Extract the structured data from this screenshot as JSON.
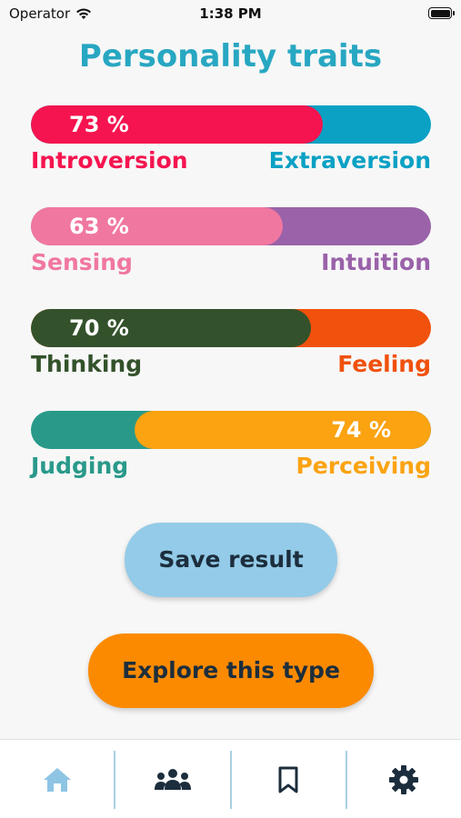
{
  "status": {
    "carrier": "Operator",
    "time": "1:38 PM"
  },
  "title": "Personality traits",
  "traits": [
    {
      "percent": 73,
      "percent_label": "73 %",
      "dominant": "left",
      "left_label": "Introversion",
      "right_label": "Extraversion",
      "left_color": "#f5144f",
      "right_color": "#0aa1c4"
    },
    {
      "percent": 63,
      "percent_label": "63 %",
      "dominant": "left",
      "left_label": "Sensing",
      "right_label": "Intuition",
      "left_color": "#f077a0",
      "right_color": "#9a62a9"
    },
    {
      "percent": 70,
      "percent_label": "70 %",
      "dominant": "left",
      "left_label": "Thinking",
      "right_label": "Feeling",
      "left_color": "#33522b",
      "right_color": "#f0510c"
    },
    {
      "percent": 74,
      "percent_label": "74 %",
      "dominant": "right",
      "left_label": "Judging",
      "right_label": "Perceiving",
      "left_color": "#29998a",
      "right_color": "#fba311"
    }
  ],
  "buttons": {
    "save": "Save result",
    "explore": "Explore this type",
    "save_color": "#93cbe8",
    "explore_color": "#fb8a00"
  },
  "tabs": [
    {
      "icon": "home-icon",
      "active": true
    },
    {
      "icon": "people-icon",
      "active": false
    },
    {
      "icon": "bookmark-icon",
      "active": false
    },
    {
      "icon": "gear-icon",
      "active": false
    }
  ]
}
